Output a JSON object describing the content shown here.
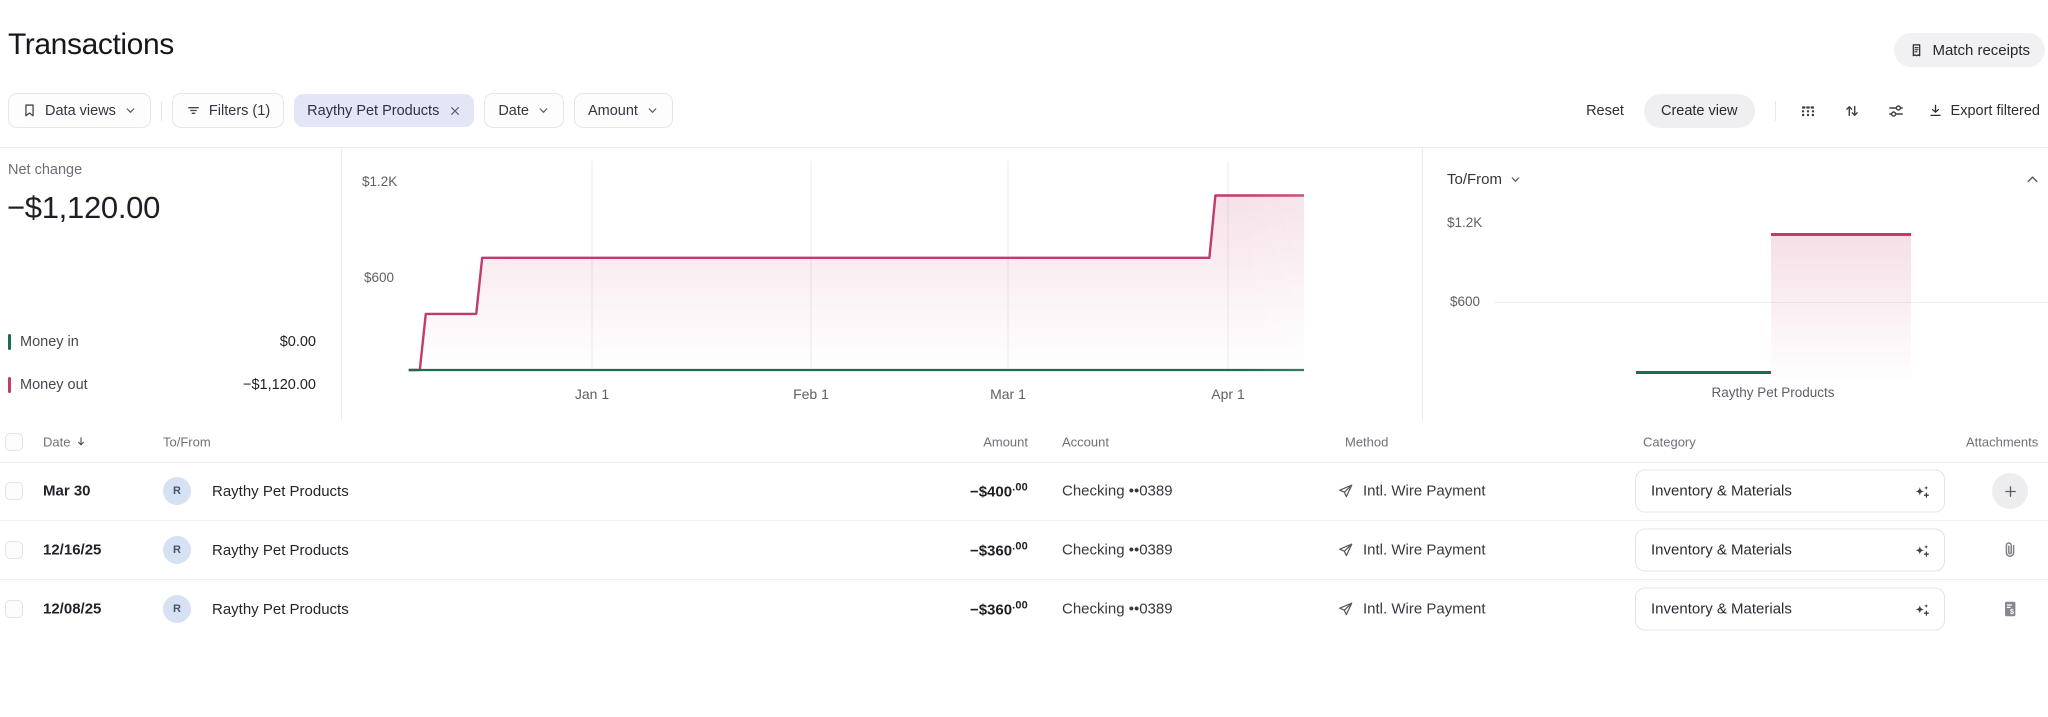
{
  "page": {
    "title": "Transactions"
  },
  "header": {
    "match_receipts": "Match receipts"
  },
  "toolbar": {
    "data_views": "Data views",
    "filters": "Filters (1)",
    "filter_chip": "Raythy Pet Products",
    "date": "Date",
    "amount": "Amount",
    "reset": "Reset",
    "create_view": "Create view",
    "export_filtered": "Export filtered"
  },
  "summary": {
    "net_change_label": "Net change",
    "net_change_value": "−$1,120.00",
    "money_in_label": "Money in",
    "money_in_value": "$0.00",
    "money_out_label": "Money out",
    "money_out_value": "−$1,120.00",
    "money_in_color": "#1d6b50",
    "money_out_color": "#c23a6e"
  },
  "tofrom": {
    "label": "To/From"
  },
  "chart_data": [
    {
      "type": "area",
      "subtype": "step-cumulative",
      "x_ticks": [
        "Jan 1",
        "Feb 1",
        "Mar 1",
        "Apr 1"
      ],
      "y_ticks": [
        "$1.2K",
        "$600"
      ],
      "ylim": [
        0,
        1430
      ],
      "grid": "vertical-months-only",
      "x_unit": "days relative to Jan 1",
      "series": [
        {
          "name": "Money out (cumulative)",
          "color": "#c23a6e",
          "points": [
            [
              -26,
              0
            ],
            [
              -24,
              360
            ],
            [
              -16,
              720
            ],
            [
              88,
              1120
            ],
            [
              101,
              1120
            ]
          ]
        },
        {
          "name": "Money in (cumulative)",
          "color": "#1d6b50",
          "points": [
            [
              -26,
              0
            ],
            [
              101,
              0
            ]
          ]
        }
      ]
    },
    {
      "type": "bar",
      "categories": [
        "Raythy Pet Products"
      ],
      "y_ticks": [
        "$1.2K",
        "$600"
      ],
      "ylim": [
        0,
        1430
      ],
      "legend_position": "none",
      "series": [
        {
          "name": "Money in",
          "color": "#1d6b50",
          "values": [
            0
          ]
        },
        {
          "name": "Money out",
          "color": "#c23a6e",
          "values": [
            1120
          ]
        }
      ]
    }
  ],
  "table": {
    "columns": {
      "date": "Date",
      "to_from": "To/From",
      "amount": "Amount",
      "account": "Account",
      "method": "Method",
      "category": "Category",
      "attachments": "Attachments"
    },
    "rows": [
      {
        "date": "Mar 30",
        "avatar": "R",
        "to_from": "Raythy Pet Products",
        "amount": "−$400",
        "cents": ".00",
        "account": "Checking ••0389",
        "method": "Intl. Wire Payment",
        "category": "Inventory & Materials",
        "attachment": "add"
      },
      {
        "date": "12/16/25",
        "avatar": "R",
        "to_from": "Raythy Pet Products",
        "amount": "−$360",
        "cents": ".00",
        "account": "Checking ••0389",
        "method": "Intl. Wire Payment",
        "category": "Inventory & Materials",
        "attachment": "paperclip"
      },
      {
        "date": "12/08/25",
        "avatar": "R",
        "to_from": "Raythy Pet Products",
        "amount": "−$360",
        "cents": ".00",
        "account": "Checking ••0389",
        "method": "Intl. Wire Payment",
        "category": "Inventory & Materials",
        "attachment": "receipt"
      }
    ]
  }
}
